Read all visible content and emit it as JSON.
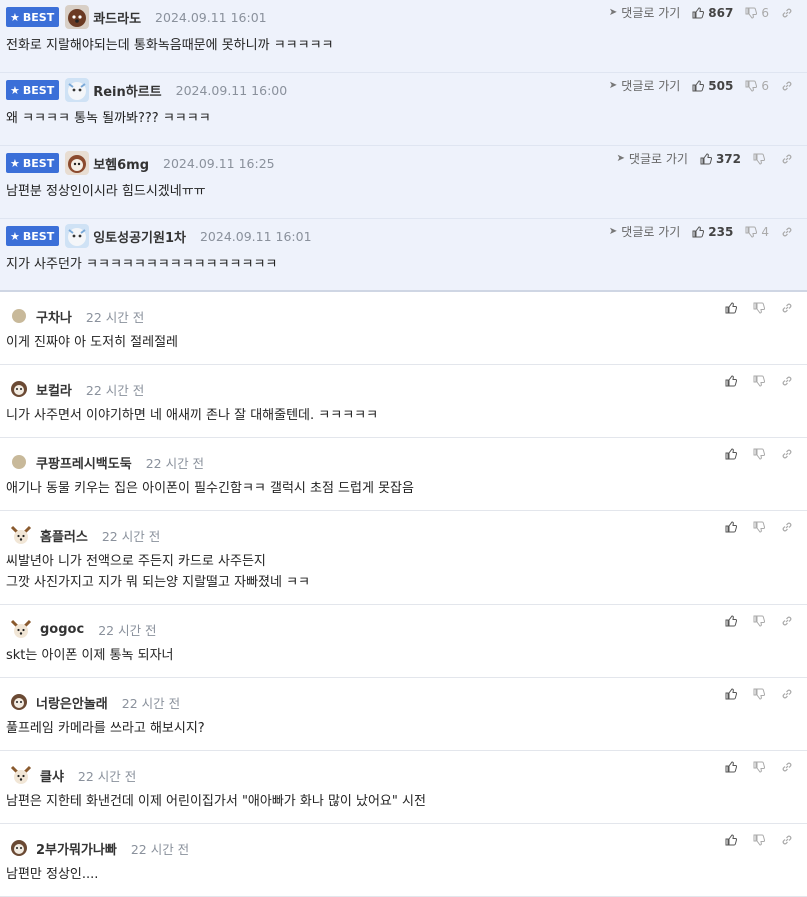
{
  "best_label": "BEST",
  "reply_label": "댓글로 가기",
  "best": [
    {
      "nick": "콰드라도",
      "time": "2024.09.11 16:01",
      "text": "전화로 지랄해야되는데 통화녹음때문에 못하니까 ㅋㅋㅋㅋㅋ",
      "up": "867",
      "down": "6"
    },
    {
      "nick": "Rein하르트",
      "time": "2024.09.11 16:00",
      "text": "왜 ㅋㅋㅋㅋ 통녹 될까봐??? ㅋㅋㅋㅋ",
      "up": "505",
      "down": "6"
    },
    {
      "nick": "보헴6mg",
      "time": "2024.09.11 16:25",
      "text": "남편분 정상인이시라 힘드시겠네ㅠㅠ",
      "up": "372",
      "down": ""
    },
    {
      "nick": "잉토성공기원1차",
      "time": "2024.09.11 16:01",
      "text": "지가 사주던가 ㅋㅋㅋㅋㅋㅋㅋㅋㅋㅋㅋㅋㅋㅋㅋㅋ",
      "up": "235",
      "down": "4"
    }
  ],
  "comments": [
    {
      "nick": "구차나",
      "time": "22 시간 전",
      "line1": "이게 진짜야 아 도저히 절레절레",
      "line2": ""
    },
    {
      "nick": "보컬라",
      "time": "22 시간 전",
      "line1": "니가 사주면서 이야기하면 네 애새끼 존나 잘 대해줄텐데. ㅋㅋㅋㅋㅋ",
      "line2": ""
    },
    {
      "nick": "쿠팡프레시백도둑",
      "time": "22 시간 전",
      "line1": "애기나 동물 키우는 집은 아이폰이 필수긴함ㅋㅋ 갤럭시 초점 드럽게 못잡음",
      "line2": ""
    },
    {
      "nick": "홈플러스",
      "time": "22 시간 전",
      "line1": "씨발년아 니가 전액으로 주든지 카드로 사주든지",
      "line2": "그깟 사진가지고 지가 뭐 되는양 지랄떨고 자빠졌네 ㅋㅋ"
    },
    {
      "nick": "gogoc",
      "time": "22 시간 전",
      "line1": "skt는 아이폰 이제 통녹 되자너",
      "line2": ""
    },
    {
      "nick": "너랑은안놀래",
      "time": "22 시간 전",
      "line1": "풀프레임 카메라를 쓰라고 해보시지?",
      "line2": ""
    },
    {
      "nick": "클샤",
      "time": "22 시간 전",
      "line1": "남편은 지한테 화낸건데 이제 어린이집가서 \"애아빠가 화나 많이 났어요\" 시전",
      "line2": ""
    },
    {
      "nick": "2부가뭐가나빠",
      "time": "22 시간 전",
      "line1": "남편만 정상인....",
      "line2": ""
    }
  ],
  "colors": {
    "accent": "#3b6fd8",
    "best_bg": "#eef2fb",
    "meta": "#8a919c"
  }
}
